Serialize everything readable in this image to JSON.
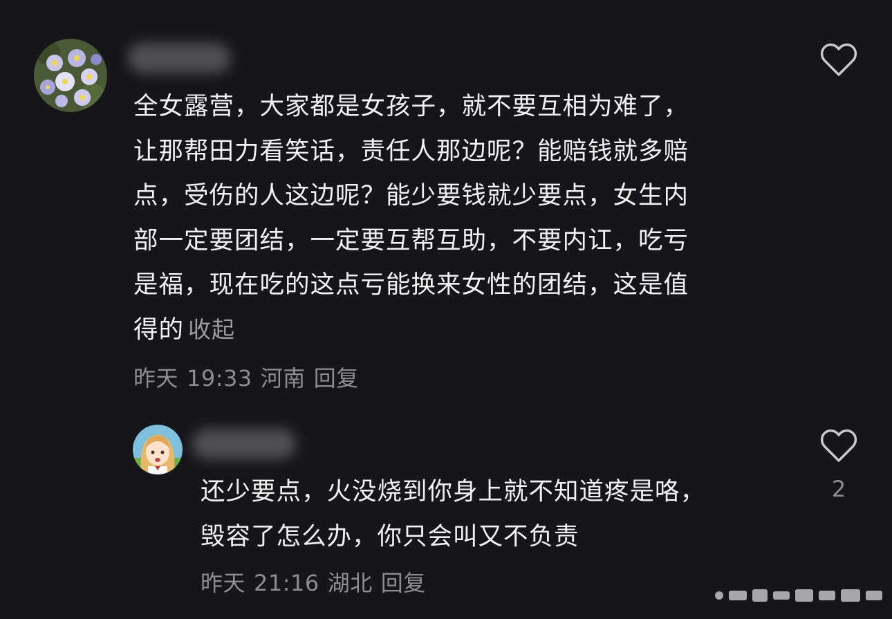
{
  "comments": [
    {
      "text": "全女露营，大家都是女孩子，就不要互相为难了，\n让那帮田力看笑话，责任人那边呢？能赔钱就多赔\n点，受伤的人这边呢？能少要钱就少要点，女生内\n部一定要团结，一定要互帮互助，不要内讧，吃亏\n是福，现在吃的这点亏能换来女性的团结，这是值\n得的",
      "collapse_label": "收起",
      "date": "昨天",
      "time": "19:33",
      "location": "河南",
      "reply_label": "回复",
      "like_icon": "heart-outline-icon",
      "avatar": "flower-pansy-avatar"
    },
    {
      "text": "还少要点，火没烧到你身上就不知道疼是咯，\n毁容了怎么办，你只会叫又不负责",
      "date": "昨天",
      "time": "21:16",
      "location": "湖北",
      "reply_label": "回复",
      "like_icon": "heart-outline-icon",
      "like_count": "2",
      "avatar": "anime-girl-avatar"
    }
  ],
  "colors": {
    "background": "#16161a",
    "text": "#f2f2f2",
    "secondary": "#8e8e91"
  }
}
